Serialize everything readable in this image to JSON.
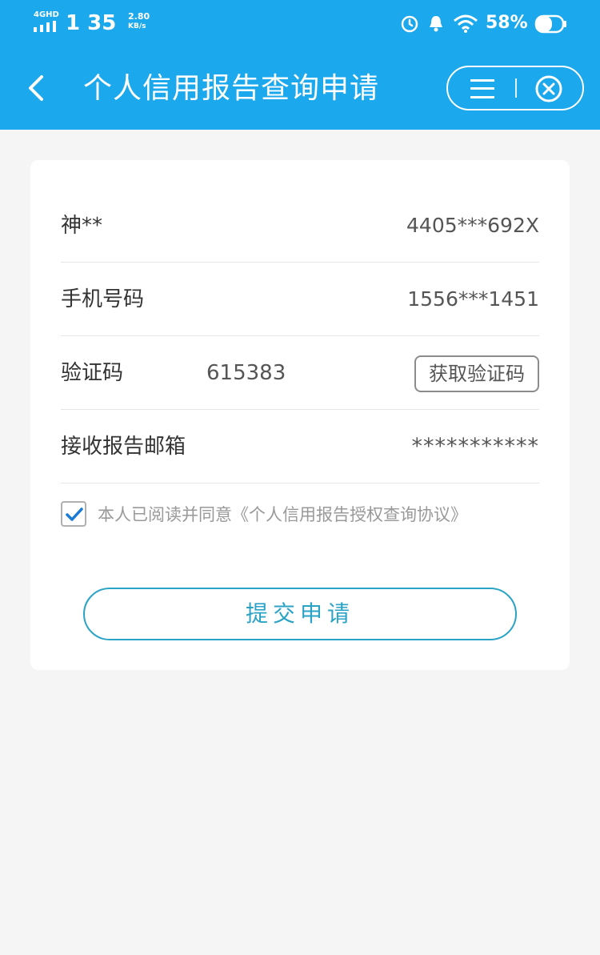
{
  "status_bar": {
    "network": "4GHD",
    "time": "1  35",
    "speed_value": "2.80",
    "speed_unit": "KB/s",
    "battery": "58%"
  },
  "nav": {
    "title": "个人信用报告查询申请",
    "back_icon": "chevron-left-icon",
    "menu_icon": "menu-icon",
    "close_icon": "close-circle-icon"
  },
  "form": {
    "name_label": "神**",
    "id_number": "4405***692X",
    "phone_label": "手机号码",
    "phone_value": "1556***1451",
    "code_label": "验证码",
    "code_value": "615383",
    "get_code_button": "获取验证码",
    "email_label": "接收报告邮箱",
    "email_value": "***********",
    "agree_text": "本人已阅读并同意《个人信用报告授权查询协议》",
    "agree_checked": true,
    "submit_button": "提交申请"
  },
  "colors": {
    "header": "#1ba8ec",
    "accent": "#2aa3c7",
    "checkbox": "#1a7bd6"
  }
}
